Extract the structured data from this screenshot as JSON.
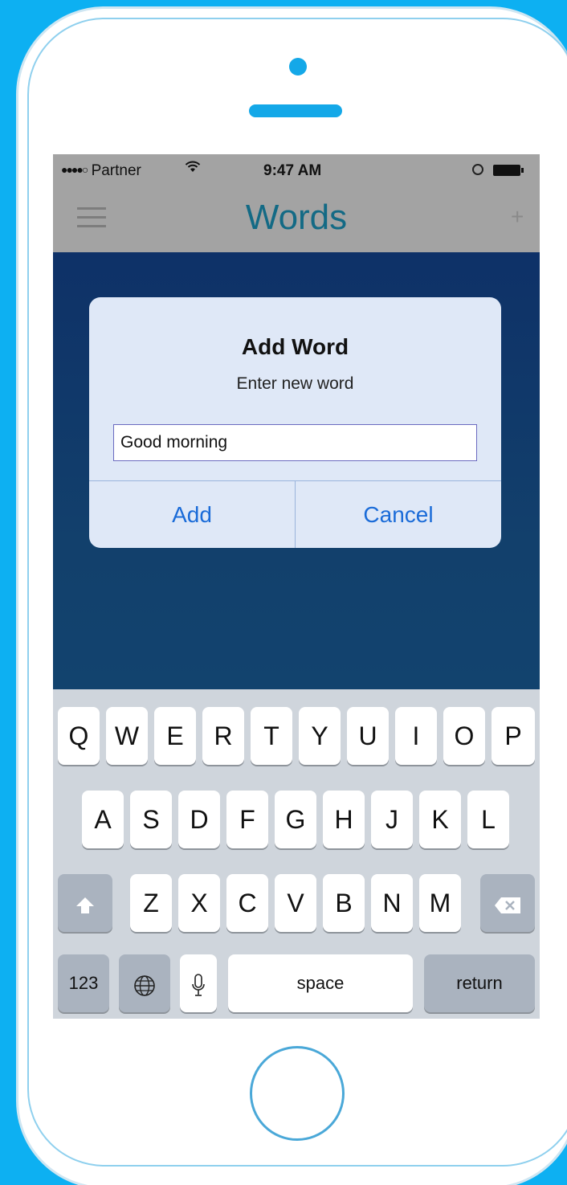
{
  "status_bar": {
    "signal": "●●●●○",
    "carrier": "Partner",
    "wifi_icon": "wifi-icon",
    "time": "9:47 AM",
    "lock_icon": "orientation-lock-icon",
    "battery_icon": "battery-icon"
  },
  "nav": {
    "title": "Words",
    "menu_icon": "hamburger-menu-icon",
    "add_label": "+"
  },
  "dialog": {
    "title": "Add Word",
    "message": "Enter new word",
    "input_value": "Good morning",
    "add_label": "Add",
    "cancel_label": "Cancel"
  },
  "keyboard": {
    "row1": [
      "Q",
      "W",
      "E",
      "R",
      "T",
      "Y",
      "U",
      "I",
      "O",
      "P"
    ],
    "row2": [
      "A",
      "S",
      "D",
      "F",
      "G",
      "H",
      "J",
      "K",
      "L"
    ],
    "row3": [
      "Z",
      "X",
      "C",
      "V",
      "B",
      "N",
      "M"
    ],
    "numbers_label": "123",
    "space_label": "space",
    "return_label": "return",
    "shift_icon": "shift-arrow-icon",
    "backspace_icon": "backspace-icon",
    "globe_icon": "globe-icon",
    "mic_icon": "microphone-icon"
  },
  "colors": {
    "background": "#0db0f2",
    "accent": "#14a8e8",
    "nav_title": "#136a85",
    "dialog_button": "#1a6bd8"
  }
}
